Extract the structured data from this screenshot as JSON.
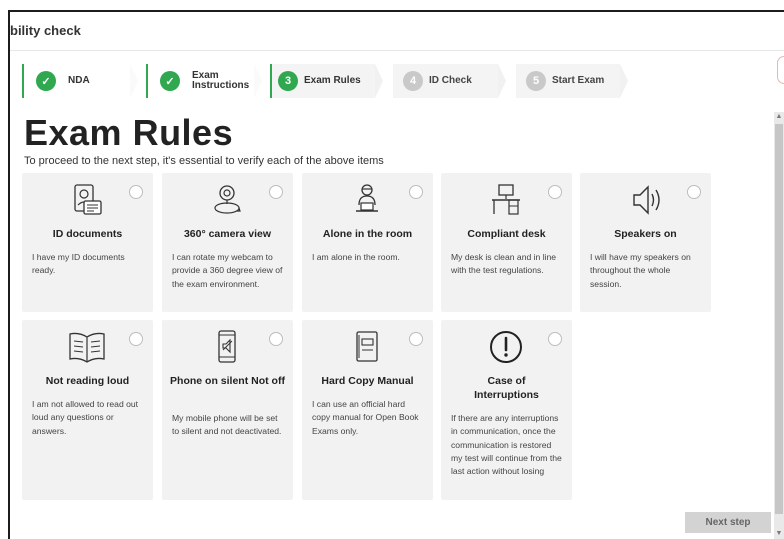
{
  "app": {
    "title": "bility check"
  },
  "steps": [
    {
      "label": "NDA",
      "state": "done",
      "badge": "✓"
    },
    {
      "label": "Exam Instructions",
      "label_line1": "Exam",
      "label_line2": "Instructions",
      "state": "done",
      "badge": "✓"
    },
    {
      "label": "Exam Rules",
      "state": "current",
      "badge": "3"
    },
    {
      "label": "ID Check",
      "state": "todo",
      "badge": "4"
    },
    {
      "label": "Start Exam",
      "state": "todo",
      "badge": "5"
    }
  ],
  "page": {
    "title": "Exam Rules",
    "subtitle": "To proceed to the next step, it's essential to verify each of the above items"
  },
  "rules": [
    {
      "title": "ID documents",
      "desc": "I have my ID documents ready.",
      "icon": "id-documents-icon"
    },
    {
      "title": "360° camera view",
      "desc": "I can rotate my webcam to provide a 360 degree view of the exam environment.",
      "icon": "camera-360-icon"
    },
    {
      "title": "Alone in the room",
      "desc": "I am alone in the room.",
      "icon": "person-at-desk-icon"
    },
    {
      "title": "Compliant desk",
      "desc": "My desk is clean and in line with the test regulations.",
      "icon": "desk-icon"
    },
    {
      "title": "Speakers on",
      "desc": "I will have my speakers on throughout the whole session.",
      "icon": "speaker-icon"
    },
    {
      "title": "Not reading loud",
      "desc": "I am not allowed to read out loud any questions or answers.",
      "icon": "book-icon"
    },
    {
      "title": "Phone on silent Not off",
      "desc": "My mobile phone will be set to silent and not deactivated.",
      "icon": "phone-silent-icon"
    },
    {
      "title": "Hard Copy Manual",
      "desc": "I can use an official hard copy manual for Open Book Exams only.",
      "icon": "manual-icon"
    },
    {
      "title": "Case of Interruptions",
      "desc": "If there are any interruptions in communication, once the communication is restored my test will continue from the last action without losing",
      "icon": "exclamation-icon"
    }
  ],
  "footer": {
    "next_label": "Next step"
  },
  "colors": {
    "accent": "#2fa84f",
    "card_bg": "#f2f2f2",
    "pending": "#c9c9c9"
  }
}
